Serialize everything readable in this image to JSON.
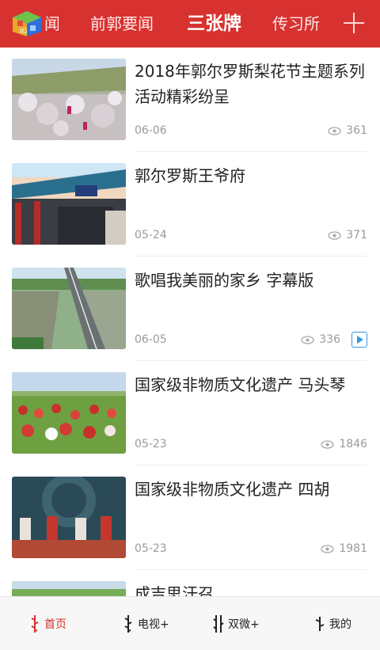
{
  "top_nav": {
    "tabs": [
      {
        "label": "闻"
      },
      {
        "label": "前郭要闻"
      },
      {
        "label": "三张牌"
      },
      {
        "label": "传习所"
      }
    ],
    "active_tab": "三张牌",
    "accent_color": "#d7322f"
  },
  "feed": {
    "items": [
      {
        "title": "2018年郭尔罗斯梨花节主题系列活动精彩纷呈",
        "date": "06-06",
        "views": "361",
        "thumb_icon": "pear-blossom-photo"
      },
      {
        "title": "郭尔罗斯王爷府",
        "date": "05-24",
        "views": "371",
        "thumb_icon": "palace-gate-photo"
      },
      {
        "title": "歌唱我美丽的家乡 字幕版",
        "date": "06-05",
        "views": "336",
        "thumb_icon": "bridge-river-photo",
        "has_video": true
      },
      {
        "title": "国家级非物质文化遗产 马头琴",
        "date": "05-23",
        "views": "1846",
        "thumb_icon": "grassland-performers-photo"
      },
      {
        "title": "国家级非物质文化遗产 四胡",
        "date": "05-23",
        "views": "1981",
        "thumb_icon": "stage-musicians-photo"
      },
      {
        "title": "成吉思汗召",
        "thumb_icon": "green-field-photo"
      }
    ]
  },
  "bottom_nav": {
    "items": [
      {
        "label": "首页",
        "icon": "mongolian-script-icon"
      },
      {
        "label": "电视+",
        "icon": "mongolian-script-icon"
      },
      {
        "label": "双微+",
        "icon": "mongolian-script-icon"
      },
      {
        "label": "我的",
        "icon": "mongolian-script-icon"
      }
    ],
    "active": "首页"
  }
}
